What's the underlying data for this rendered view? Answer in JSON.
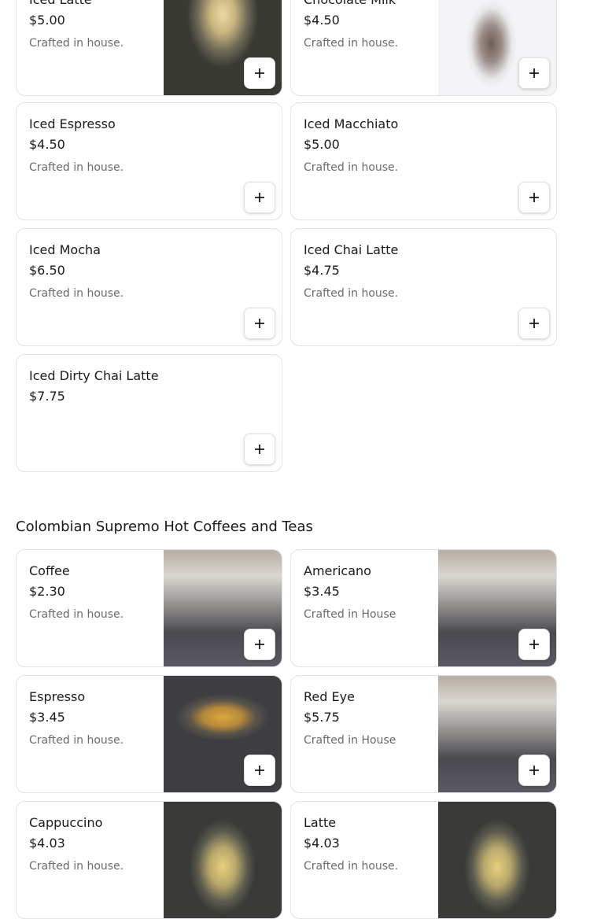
{
  "colors": {
    "border": "#e2e2e2",
    "text": "#1a1a1a",
    "muted": "#6b6b6b"
  },
  "cards_top": [
    {
      "name": "Iced Latte",
      "price": "$5.00",
      "desc": "Crafted in house."
    },
    {
      "name": "Chocolate Milk",
      "price": "$4.50",
      "desc": "Crafted in house."
    },
    {
      "name": "Iced Espresso",
      "price": "$4.50",
      "desc": "Crafted in house."
    },
    {
      "name": "Iced Macchiato",
      "price": "$5.00",
      "desc": "Crafted in house."
    },
    {
      "name": "Iced Mocha",
      "price": "$6.50",
      "desc": "Crafted in house."
    },
    {
      "name": "Iced Chai Latte",
      "price": "$4.75",
      "desc": "Crafted in house."
    },
    {
      "name": "Iced Dirty Chai Latte",
      "price": "$7.75",
      "desc": ""
    }
  ],
  "section": {
    "title": "Colombian Supremo Hot Coffees and Teas"
  },
  "cards_hot": [
    {
      "name": "Coffee",
      "price": "$2.30",
      "desc": "Crafted in house."
    },
    {
      "name": "Americano",
      "price": "$3.45",
      "desc": "Crafted in House"
    },
    {
      "name": "Espresso",
      "price": "$3.45",
      "desc": "Crafted in house."
    },
    {
      "name": "Red Eye",
      "price": "$5.75",
      "desc": "Crafted in House"
    },
    {
      "name": "Cappuccino",
      "price": "$4.03",
      "desc": "Crafted in house."
    },
    {
      "name": "Latte",
      "price": "$4.03",
      "desc": "Crafted in house."
    }
  ],
  "icons": {
    "add": "plus-icon"
  }
}
